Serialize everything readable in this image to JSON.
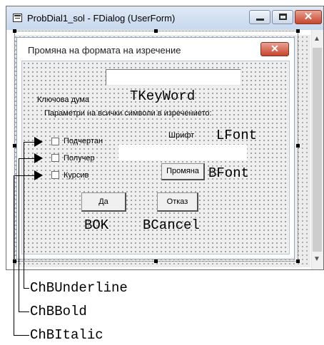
{
  "window": {
    "title": "ProbDial1_sol - FDialog (UserForm)",
    "close_glyph": "✕"
  },
  "scrollbar": {
    "up_glyph": "▲",
    "down_glyph": "▼"
  },
  "userform": {
    "title": "Промяна на формата на изречение",
    "close_glyph": "✕"
  },
  "controls": {
    "keyword_label": "Ключова дума",
    "keyword_name": "TKeyWord",
    "params_label": "Параметри на всички символи в изречението:",
    "underline_label": "Подчертан",
    "bold_label": "Получер",
    "italic_label": "Курсив",
    "font_label": "Шрифт",
    "font_label_name": "LFont",
    "font_button_label": "Промяна",
    "font_button_name": "BFont",
    "ok_label": "Да",
    "ok_name": "BOK",
    "cancel_label": "Отказ",
    "cancel_name": "BCancel"
  },
  "annotations": {
    "underline": "ChBUnderline",
    "bold": "ChBBold",
    "italic": "ChBItalic"
  }
}
